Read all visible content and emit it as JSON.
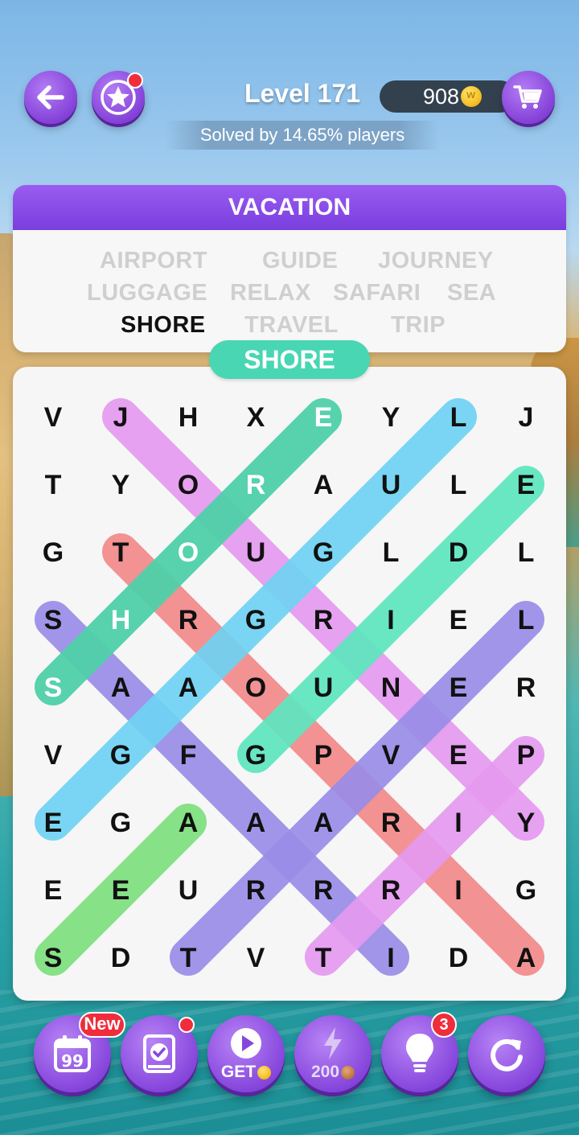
{
  "level": {
    "title": "Level 171",
    "solved_text": "Solved by 14.65% players"
  },
  "coins": "908",
  "category": "VACATION",
  "words": [
    {
      "text": "AIRPORT",
      "found": true
    },
    {
      "text": "GUIDE",
      "found": true
    },
    {
      "text": "JOURNEY",
      "found": true
    },
    {
      "text": "LUGGAGE",
      "found": true
    },
    {
      "text": "RELAX",
      "found": true
    },
    {
      "text": "SAFARI",
      "found": true
    },
    {
      "text": "SEA",
      "found": true
    },
    {
      "text": "SHORE",
      "found": false
    },
    {
      "text": "TRAVEL",
      "found": true
    },
    {
      "text": "TRIP",
      "found": true
    }
  ],
  "current_word": "SHORE",
  "grid": [
    [
      "V",
      "J",
      "H",
      "X",
      "E",
      "Y",
      "L",
      "J"
    ],
    [
      "T",
      "Y",
      "O",
      "R",
      "A",
      "U",
      "L",
      "E"
    ],
    [
      "G",
      "T",
      "O",
      "U",
      "G",
      "L",
      "D",
      "L"
    ],
    [
      "S",
      "H",
      "R",
      "G",
      "R",
      "I",
      "E",
      "L"
    ],
    [
      "S",
      "A",
      "A",
      "O",
      "U",
      "N",
      "E",
      "R"
    ],
    [
      "V",
      "G",
      "F",
      "G",
      "P",
      "V",
      "E",
      "P"
    ],
    [
      "E",
      "G",
      "A",
      "A",
      "A",
      "R",
      "I",
      "Y"
    ],
    [
      "E",
      "E",
      "U",
      "R",
      "R",
      "R",
      "I",
      "G"
    ],
    [
      "S",
      "D",
      "T",
      "V",
      "T",
      "I",
      "D",
      "A"
    ]
  ],
  "highlights": [
    {
      "word": "JOURNEY",
      "from": [
        0,
        1
      ],
      "to": [
        6,
        7
      ],
      "color": "#e59af0"
    },
    {
      "word": "AIRPORT",
      "from": [
        8,
        7
      ],
      "to": [
        2,
        1
      ],
      "color": "#f28a8a"
    },
    {
      "word": "TRAVEL",
      "from": [
        8,
        2
      ],
      "to": [
        3,
        7
      ],
      "color": "#9a8de8"
    },
    {
      "word": "SAFARI",
      "from": [
        3,
        0
      ],
      "to": [
        8,
        5
      ],
      "color": "#9a8de8"
    },
    {
      "word": "LUGGAGE",
      "from": [
        0,
        6
      ],
      "to": [
        6,
        0
      ],
      "color": "#6fd3f3"
    },
    {
      "word": "GUIDE",
      "from": [
        5,
        3
      ],
      "to": [
        1,
        7
      ],
      "color": "#5ee6bf"
    },
    {
      "word": "TRIP",
      "from": [
        8,
        4
      ],
      "to": [
        5,
        7
      ],
      "color": "#e59af0"
    },
    {
      "word": "SEA",
      "from": [
        8,
        0
      ],
      "to": [
        6,
        2
      ],
      "color": "#7ee07e"
    },
    {
      "word": "SHORE",
      "from": [
        4,
        0
      ],
      "to": [
        0,
        4
      ],
      "color": "#4fd1a9",
      "active": true
    }
  ],
  "colors": {
    "text_dark": "#111111",
    "text_active": "#ffffff",
    "accent": "#8244d9",
    "current_word": "#48d6b3"
  },
  "toolbar": {
    "calendar_badge": "New",
    "get_label": "GET",
    "energy_cost": "200",
    "hint_count": "3"
  }
}
